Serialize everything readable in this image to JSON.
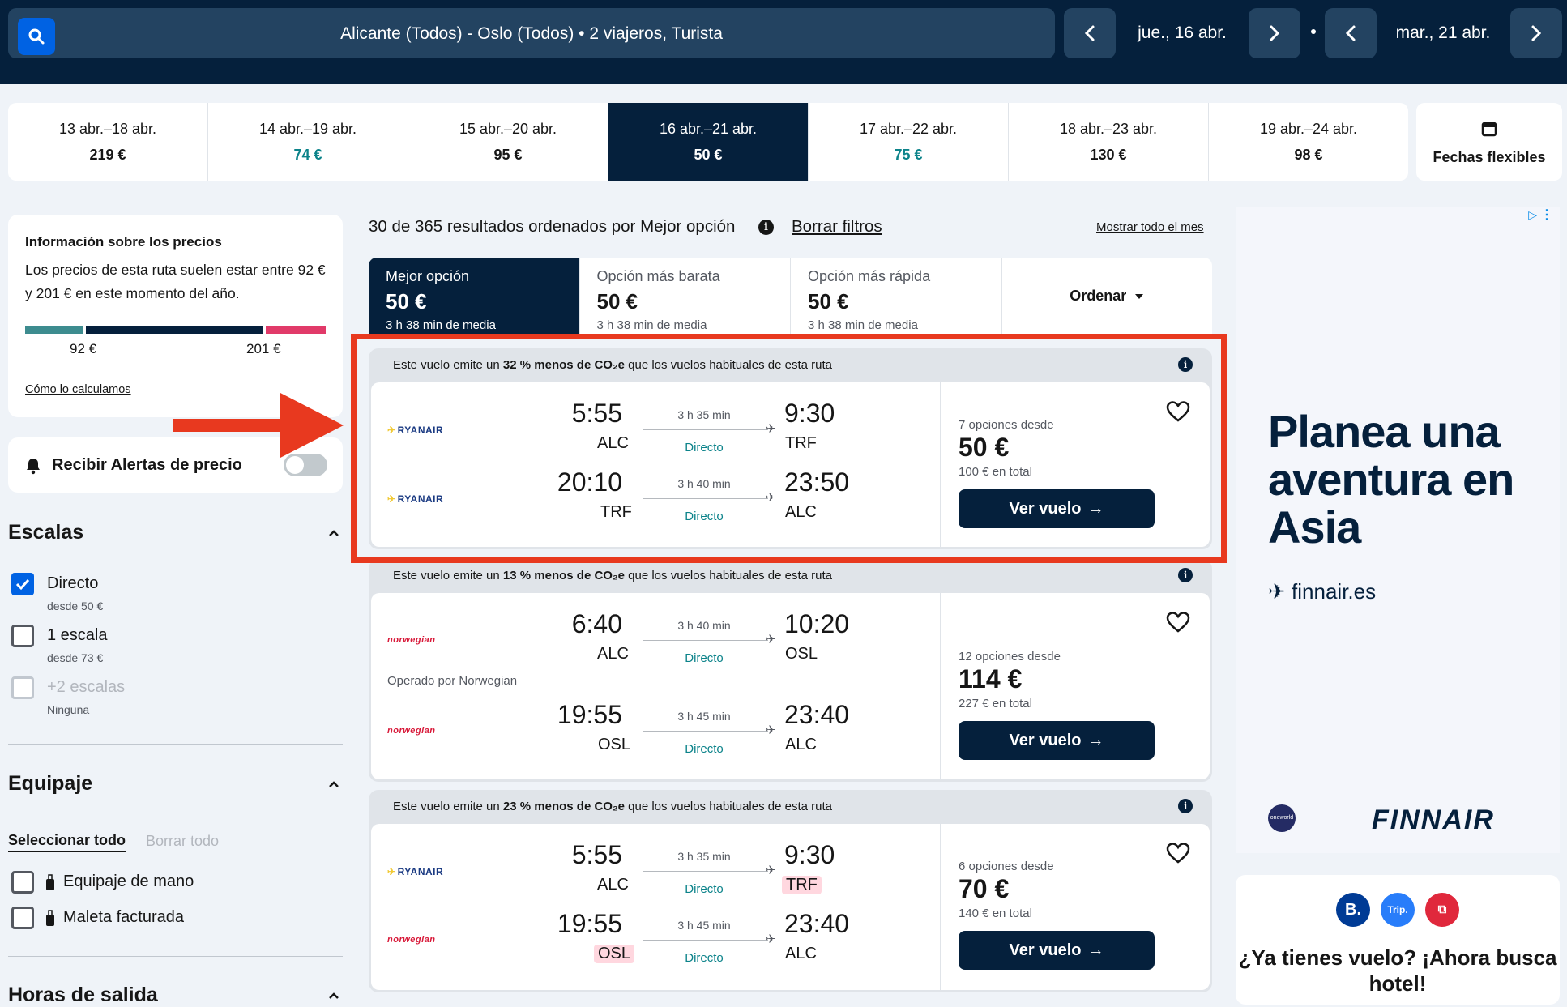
{
  "search": {
    "summary": "Alicante (Todos) - Oslo (Todos)  •  2 viajeros, Turista",
    "depart_date": "jue., 16 abr.",
    "return_date": "mar., 21 abr."
  },
  "date_strip": [
    {
      "range": "13 abr.–18 abr.",
      "price": "219 €",
      "state": "normal"
    },
    {
      "range": "14 abr.–19 abr.",
      "price": "74 €",
      "state": "cheap"
    },
    {
      "range": "15 abr.–20 abr.",
      "price": "95 €",
      "state": "normal"
    },
    {
      "range": "16 abr.–21 abr.",
      "price": "50 €",
      "state": "selected"
    },
    {
      "range": "17 abr.–22 abr.",
      "price": "75 €",
      "state": "cheap"
    },
    {
      "range": "18 abr.–23 abr.",
      "price": "130 €",
      "state": "normal"
    },
    {
      "range": "19 abr.–24 abr.",
      "price": "98 €",
      "state": "normal"
    }
  ],
  "flex_dates": "Fechas flexibles",
  "price_info": {
    "title": "Información sobre los precios",
    "desc": "Los precios de esta ruta suelen estar entre 92 € y 201 € en este momento del año.",
    "low": "92 €",
    "high": "201 €",
    "link": "Cómo lo calculamos"
  },
  "alerts": {
    "label": "Recibir Alertas de precio"
  },
  "stops": {
    "title": "Escalas",
    "options": [
      {
        "label": "Directo",
        "sub": "desde 50 €",
        "state": "checked"
      },
      {
        "label": "1 escala",
        "sub": "desde 73 €",
        "state": "unchecked"
      },
      {
        "label": "+2 escalas",
        "sub": "Ninguna",
        "state": "disabled"
      }
    ]
  },
  "baggage": {
    "title": "Equipaje",
    "select_all": "Seleccionar todo",
    "clear_all": "Borrar todo",
    "options": [
      {
        "label": "Equipaje de mano"
      },
      {
        "label": "Maleta facturada"
      }
    ]
  },
  "departure_times": {
    "title": "Horas de salida"
  },
  "results": {
    "summary": "30 de 365 resultados ordenados por Mejor opción",
    "clear_filters": "Borrar filtros",
    "show_month": "Mostrar todo el mes"
  },
  "sort_tabs": [
    {
      "name": "Mejor opción",
      "price": "50 €",
      "meta": "3 h 38 min de media",
      "selected": true
    },
    {
      "name": "Opción más barata",
      "price": "50 €",
      "meta": "3 h 38 min de media",
      "selected": false
    },
    {
      "name": "Opción más rápida",
      "price": "50 €",
      "meta": "3 h 38 min de media",
      "selected": false
    }
  ],
  "sort_label": "Ordenar",
  "flights": [
    {
      "co2_pre": "Este vuelo emite un ",
      "co2_bold": "32 % menos de CO₂e",
      "co2_post": " que los vuelos habituales de esta ruta",
      "legs": [
        {
          "airline": "RYANAIR",
          "dep": "5:55",
          "from": "ALC",
          "duration": "3 h 35 min",
          "stops": "Directo",
          "arr": "9:30",
          "to": "TRF"
        },
        {
          "airline": "RYANAIR",
          "dep": "20:10",
          "from": "TRF",
          "duration": "3 h 40 min",
          "stops": "Directo",
          "arr": "23:50",
          "to": "ALC"
        }
      ],
      "options": "7 opciones desde",
      "price": "50 €",
      "total": "100 € en total",
      "button": "Ver vuelo"
    },
    {
      "co2_pre": "Este vuelo emite un ",
      "co2_bold": "13 % menos de CO₂e",
      "co2_post": " que los vuelos habituales de esta ruta",
      "operated": "Operado por Norwegian",
      "legs": [
        {
          "airline": "norwegian",
          "dep": "6:40",
          "from": "ALC",
          "duration": "3 h 40 min",
          "stops": "Directo",
          "arr": "10:20",
          "to": "OSL"
        },
        {
          "airline": "norwegian",
          "dep": "19:55",
          "from": "OSL",
          "duration": "3 h 45 min",
          "stops": "Directo",
          "arr": "23:40",
          "to": "ALC"
        }
      ],
      "options": "12 opciones desde",
      "price": "114 €",
      "total": "227 € en total",
      "button": "Ver vuelo"
    },
    {
      "co2_pre": "Este vuelo emite un ",
      "co2_bold": "23 % menos de CO₂e",
      "co2_post": " que los vuelos habituales de esta ruta",
      "legs": [
        {
          "airline": "RYANAIR",
          "dep": "5:55",
          "from": "ALC",
          "duration": "3 h 35 min",
          "stops": "Directo",
          "arr": "9:30",
          "to": "TRF"
        },
        {
          "airline": "norwegian",
          "dep": "19:55",
          "from": "OSL",
          "duration": "3 h 45 min",
          "stops": "Directo",
          "arr": "23:40",
          "to": "ALC"
        }
      ],
      "options": "6 opciones desde",
      "price": "70 €",
      "total": "140 € en total",
      "button": "Ver vuelo"
    }
  ],
  "ad": {
    "title": "Planea una aventura en Asia",
    "site": "finnair.es",
    "brand": "FINNAIR",
    "alliance": "oneworld"
  },
  "ad2": {
    "title": "¿Ya tienes vuelo? ¡Ahora busca hotel!",
    "badges": [
      "B.",
      "Trip."
    ]
  },
  "colors": {
    "navy": "#05203c",
    "blue": "#0062e3",
    "teal": "#0c838a",
    "annotation_red": "#e8391f",
    "pink": "#e13a69"
  },
  "icons": [
    "search-icon",
    "chevron-left-icon",
    "chevron-right-icon",
    "calendar-icon",
    "bell-icon",
    "chevron-up-icon",
    "info-icon",
    "heart-icon",
    "plane-icon",
    "arrow-right-icon",
    "bag-icon",
    "adchoices-icon",
    "kebab-icon"
  ]
}
